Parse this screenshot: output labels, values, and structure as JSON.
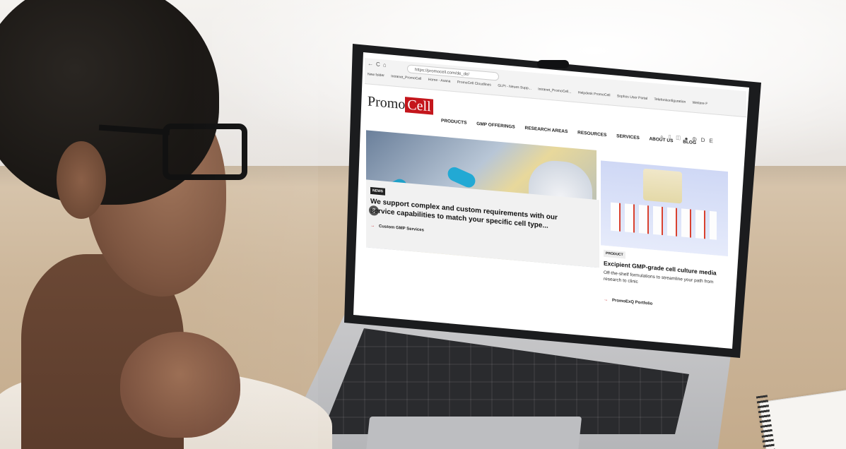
{
  "browser": {
    "url": "https://promocell.com/de_de/",
    "bookmarks": [
      "New folder",
      "Intranet_PromoCell",
      "Home - Asana",
      "PromoCell Cloudlines",
      "GLPI - Neues Supp...",
      "Intranet_PromoCell...",
      "Helpdesk PromoCell",
      "Sophos User Portal",
      "Telefonkonfiguration",
      "Weitere F"
    ]
  },
  "site": {
    "logo_text": "Promo",
    "logo_highlight": "Cell",
    "menu": [
      "PRODUCTS",
      "GMP OFFERINGS",
      "RESEARCH AREAS",
      "RESOURCES",
      "SERVICES",
      "ABOUT US",
      "BLOG"
    ],
    "lang": "DE",
    "news": {
      "badge": "NEWS",
      "title": "We support complex and custom requirements with our service capabilities to match your specific cell type...",
      "link": "Custom GMP Services"
    },
    "product": {
      "badge": "PRODUCT",
      "title": "Excipient GMP-grade cell culture media",
      "description": "Off-the-shelf formulations to streamline your path from research to clinic",
      "link": "PromoExQ Portfolio"
    }
  },
  "colors": {
    "brand_red": "#c4161c",
    "glove_blue": "#1fa0c8"
  }
}
